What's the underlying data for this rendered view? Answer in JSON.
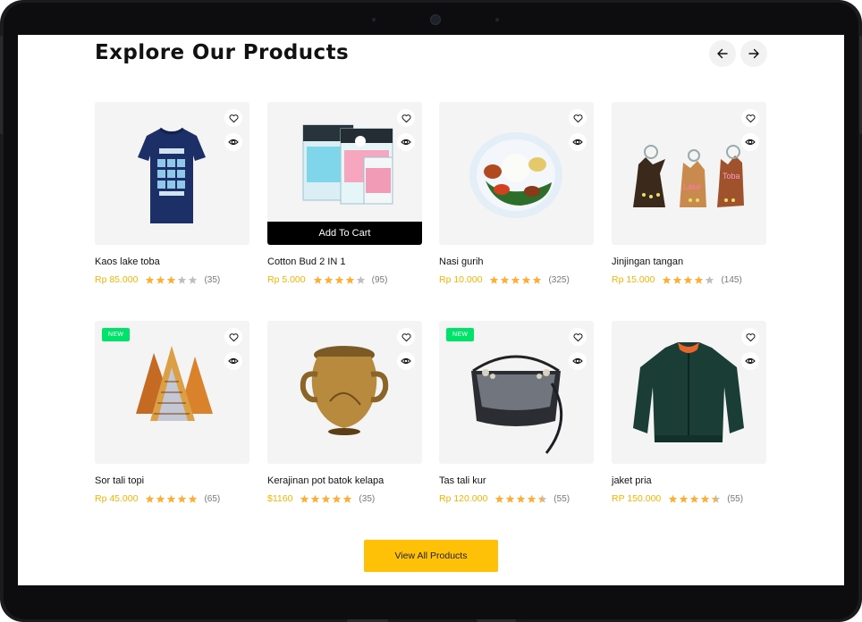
{
  "section": {
    "title": "Explore Our Products",
    "view_all_label": "View All Products"
  },
  "products": [
    {
      "name": "Kaos lake toba",
      "price": "Rp 85.000",
      "rating": 3,
      "reviews": "(35)",
      "badge": "",
      "image": "t-shirt",
      "hovered": false
    },
    {
      "name": "Cotton Bud 2 IN 1",
      "price": "Rp 5.000",
      "rating": 4,
      "reviews": "(95)",
      "badge": "",
      "image": "cotton-buds",
      "hovered": true,
      "add_to_cart_label": "Add To Cart"
    },
    {
      "name": "Nasi gurih",
      "price": "Rp 10.000",
      "rating": 5,
      "reviews": "(325)",
      "badge": "",
      "image": "rice-dish",
      "hovered": false
    },
    {
      "name": "Jinjingan tangan",
      "price": "Rp 15.000",
      "rating": 4,
      "reviews": "(145)",
      "badge": "",
      "image": "keychains",
      "hovered": false
    },
    {
      "name": "Sor tali topi",
      "price": "Rp 45.000",
      "rating": 5,
      "reviews": "(65)",
      "badge": "NEW",
      "image": "woven-hats",
      "hovered": false
    },
    {
      "name": "Kerajinan pot batok kelapa",
      "price": "$1160",
      "rating": 5,
      "reviews": "(35)",
      "badge": "",
      "image": "coconut-pot",
      "hovered": false
    },
    {
      "name": "Tas tali kur",
      "price": "Rp 120.000",
      "rating": 4.5,
      "reviews": "(55)",
      "badge": "NEW",
      "image": "macrame-bag",
      "hovered": false
    },
    {
      "name": "jaket pria",
      "price": "RP 150.000",
      "rating": 4.5,
      "reviews": "(55)",
      "badge": "",
      "image": "bomber-jacket",
      "hovered": false
    }
  ],
  "colors": {
    "price": "#f5b400",
    "star_filled": "#ffad33",
    "star_empty": "#bfbfbf",
    "badge": "#00e36b",
    "button": "#ffc107"
  },
  "icons": {
    "prev": "arrow-left-icon",
    "next": "arrow-right-icon",
    "favorite": "heart-icon",
    "quick_view": "eye-icon",
    "rating": "star-icon"
  }
}
